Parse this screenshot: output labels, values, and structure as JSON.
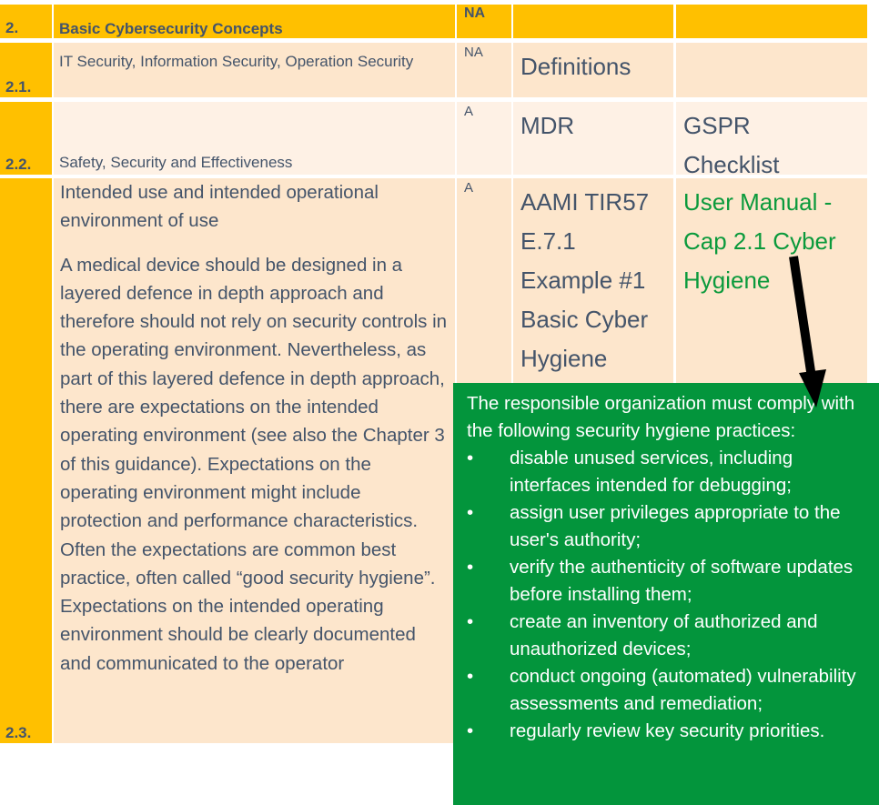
{
  "table": {
    "header": {
      "num": "2.",
      "title": "Basic Cybersecurity Concepts",
      "applicability": "NA",
      "reference": "",
      "evidence": ""
    },
    "rows": [
      {
        "num": "2.1.",
        "title": "IT Security, Information Security, Operation Security",
        "applicability": "NA",
        "reference": "Definitions",
        "evidence": ""
      },
      {
        "num": "2.2.",
        "title": "Safety, Security and Effectiveness",
        "applicability": "A",
        "reference": "MDR",
        "evidence": "GSPR Checklist"
      },
      {
        "num": "2.3.",
        "title": "Intended use and intended operational environment of use",
        "description": "A medical device should be designed in a layered defence in depth approach and therefore should not rely on security controls in the operating environment. Nevertheless, as part of this layered defence in depth approach, there are expectations on the intended operating environment (see also the Chapter 3 of this guidance). Expectations on the operating environment might include protection and performance characteristics. Often the expectations are common best practice, often called “good security hygiene”. Expectations on the intended operating environment should be clearly documented and communicated to the operator",
        "applicability": "A",
        "reference": "AAMI TIR57 E.7.1 Example #1 Basic Cyber Hygiene",
        "evidence": "User Manual - Cap 2.1 Cyber Hygiene"
      }
    ]
  },
  "callout": {
    "intro": "The responsible organization must comply with the following security hygiene practices:",
    "bullet_glyph": "•",
    "items": [
      "disable unused services, including interfaces intended for debugging;",
      "assign user privileges appropriate to the user's authority;",
      "verify the authenticity of software updates before installing them;",
      "create an inventory of authorized and unauthorized devices;",
      "conduct ongoing (automated) vulnerability assessments and remediation;",
      "regularly review key security priorities."
    ]
  },
  "colors": {
    "header": "#FFC000",
    "row_light": "#FDE6CC",
    "row_lighter": "#FEF1E5",
    "callout": "#03953C",
    "link_green": "#0B9A3C",
    "text": "#44546A"
  }
}
